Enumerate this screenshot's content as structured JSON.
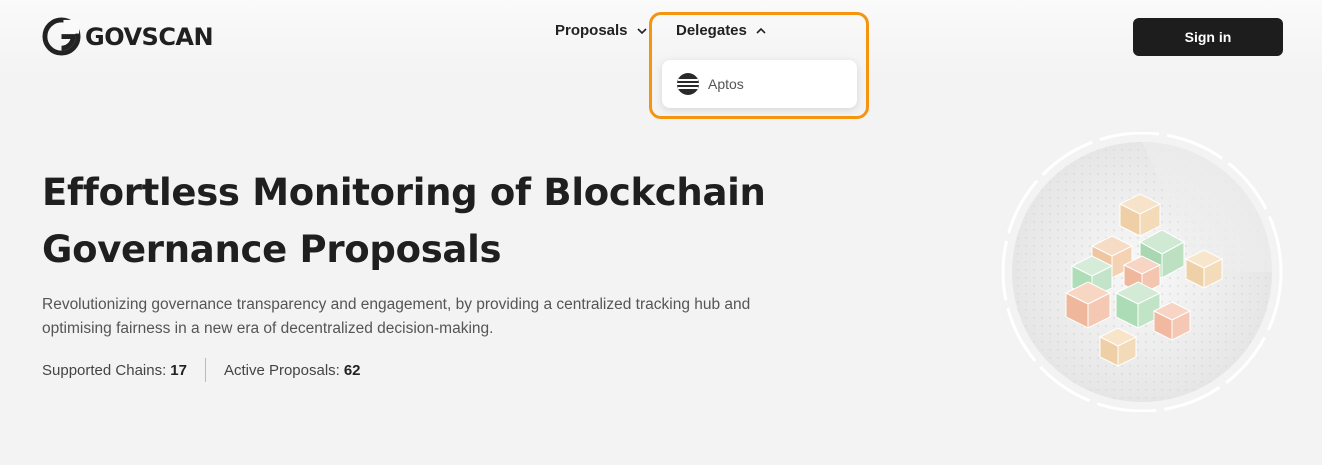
{
  "brand": {
    "name": "GOVSCAN"
  },
  "nav": {
    "proposals_label": "Proposals",
    "delegates_label": "Delegates",
    "delegates_menu": [
      {
        "label": "Aptos",
        "icon": "aptos-icon"
      }
    ]
  },
  "header": {
    "signin_label": "Sign in"
  },
  "hero": {
    "title": "Effortless Monitoring of Blockchain Governance Proposals",
    "description": "Revolutionizing governance transparency and engagement, by providing a centralized tracking hub and optimising fairness in a new era of decentralized decision-making.",
    "stats": [
      {
        "label": "Supported Chains:",
        "value": "17"
      },
      {
        "label": "Active Proposals:",
        "value": "62"
      }
    ]
  },
  "colors": {
    "highlight": "#f5950f",
    "signin_bg": "#1d1d1d",
    "background": "#f3f3f3"
  }
}
